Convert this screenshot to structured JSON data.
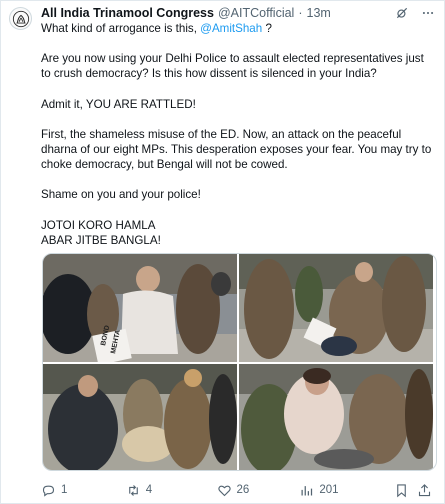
{
  "tweet": {
    "author_name": "All India Trinamool Congress",
    "author_handle": "@AITCofficial",
    "separator": "·",
    "time": "13m",
    "text_lines": {
      "p1_pre": "What kind of arrogance is this, ",
      "p1_mention": "@AmitShah",
      "p1_post": " ?",
      "p2": "Are you now using your Delhi Police to assault elected representatives just to crush democracy? Is this how dissent is silenced in your India?",
      "p3": "Admit it, YOU ARE RATTLED!",
      "p4": "First, the shameless misuse of the ED. Now, an attack on the peaceful dharna of our eight MPs. This desperation exposes your fear. You may try to choke democracy, but Bengal will not be cowed.",
      "p5": "Shame on you and your police!",
      "p6a": "JOTOI KORO HAMLA",
      "p6b": "ABAR JITBE BANGLA!"
    },
    "header_icons": [
      "grok-icon",
      "more-icon"
    ],
    "media": [
      {
        "name": "protest-photo-1",
        "sign_text": "BOND\nMEHTA"
      },
      {
        "name": "protest-photo-2",
        "sign_text": ""
      },
      {
        "name": "protest-photo-3",
        "sign_text": ""
      },
      {
        "name": "protest-photo-4",
        "sign_text": ""
      }
    ],
    "actions": {
      "reply_count": "1",
      "retweet_count": "4",
      "like_count": "26",
      "views_count": "201"
    }
  },
  "colors": {
    "link": "#1d9bf0",
    "secondary_text": "#536471",
    "border": "#cfd9de"
  }
}
